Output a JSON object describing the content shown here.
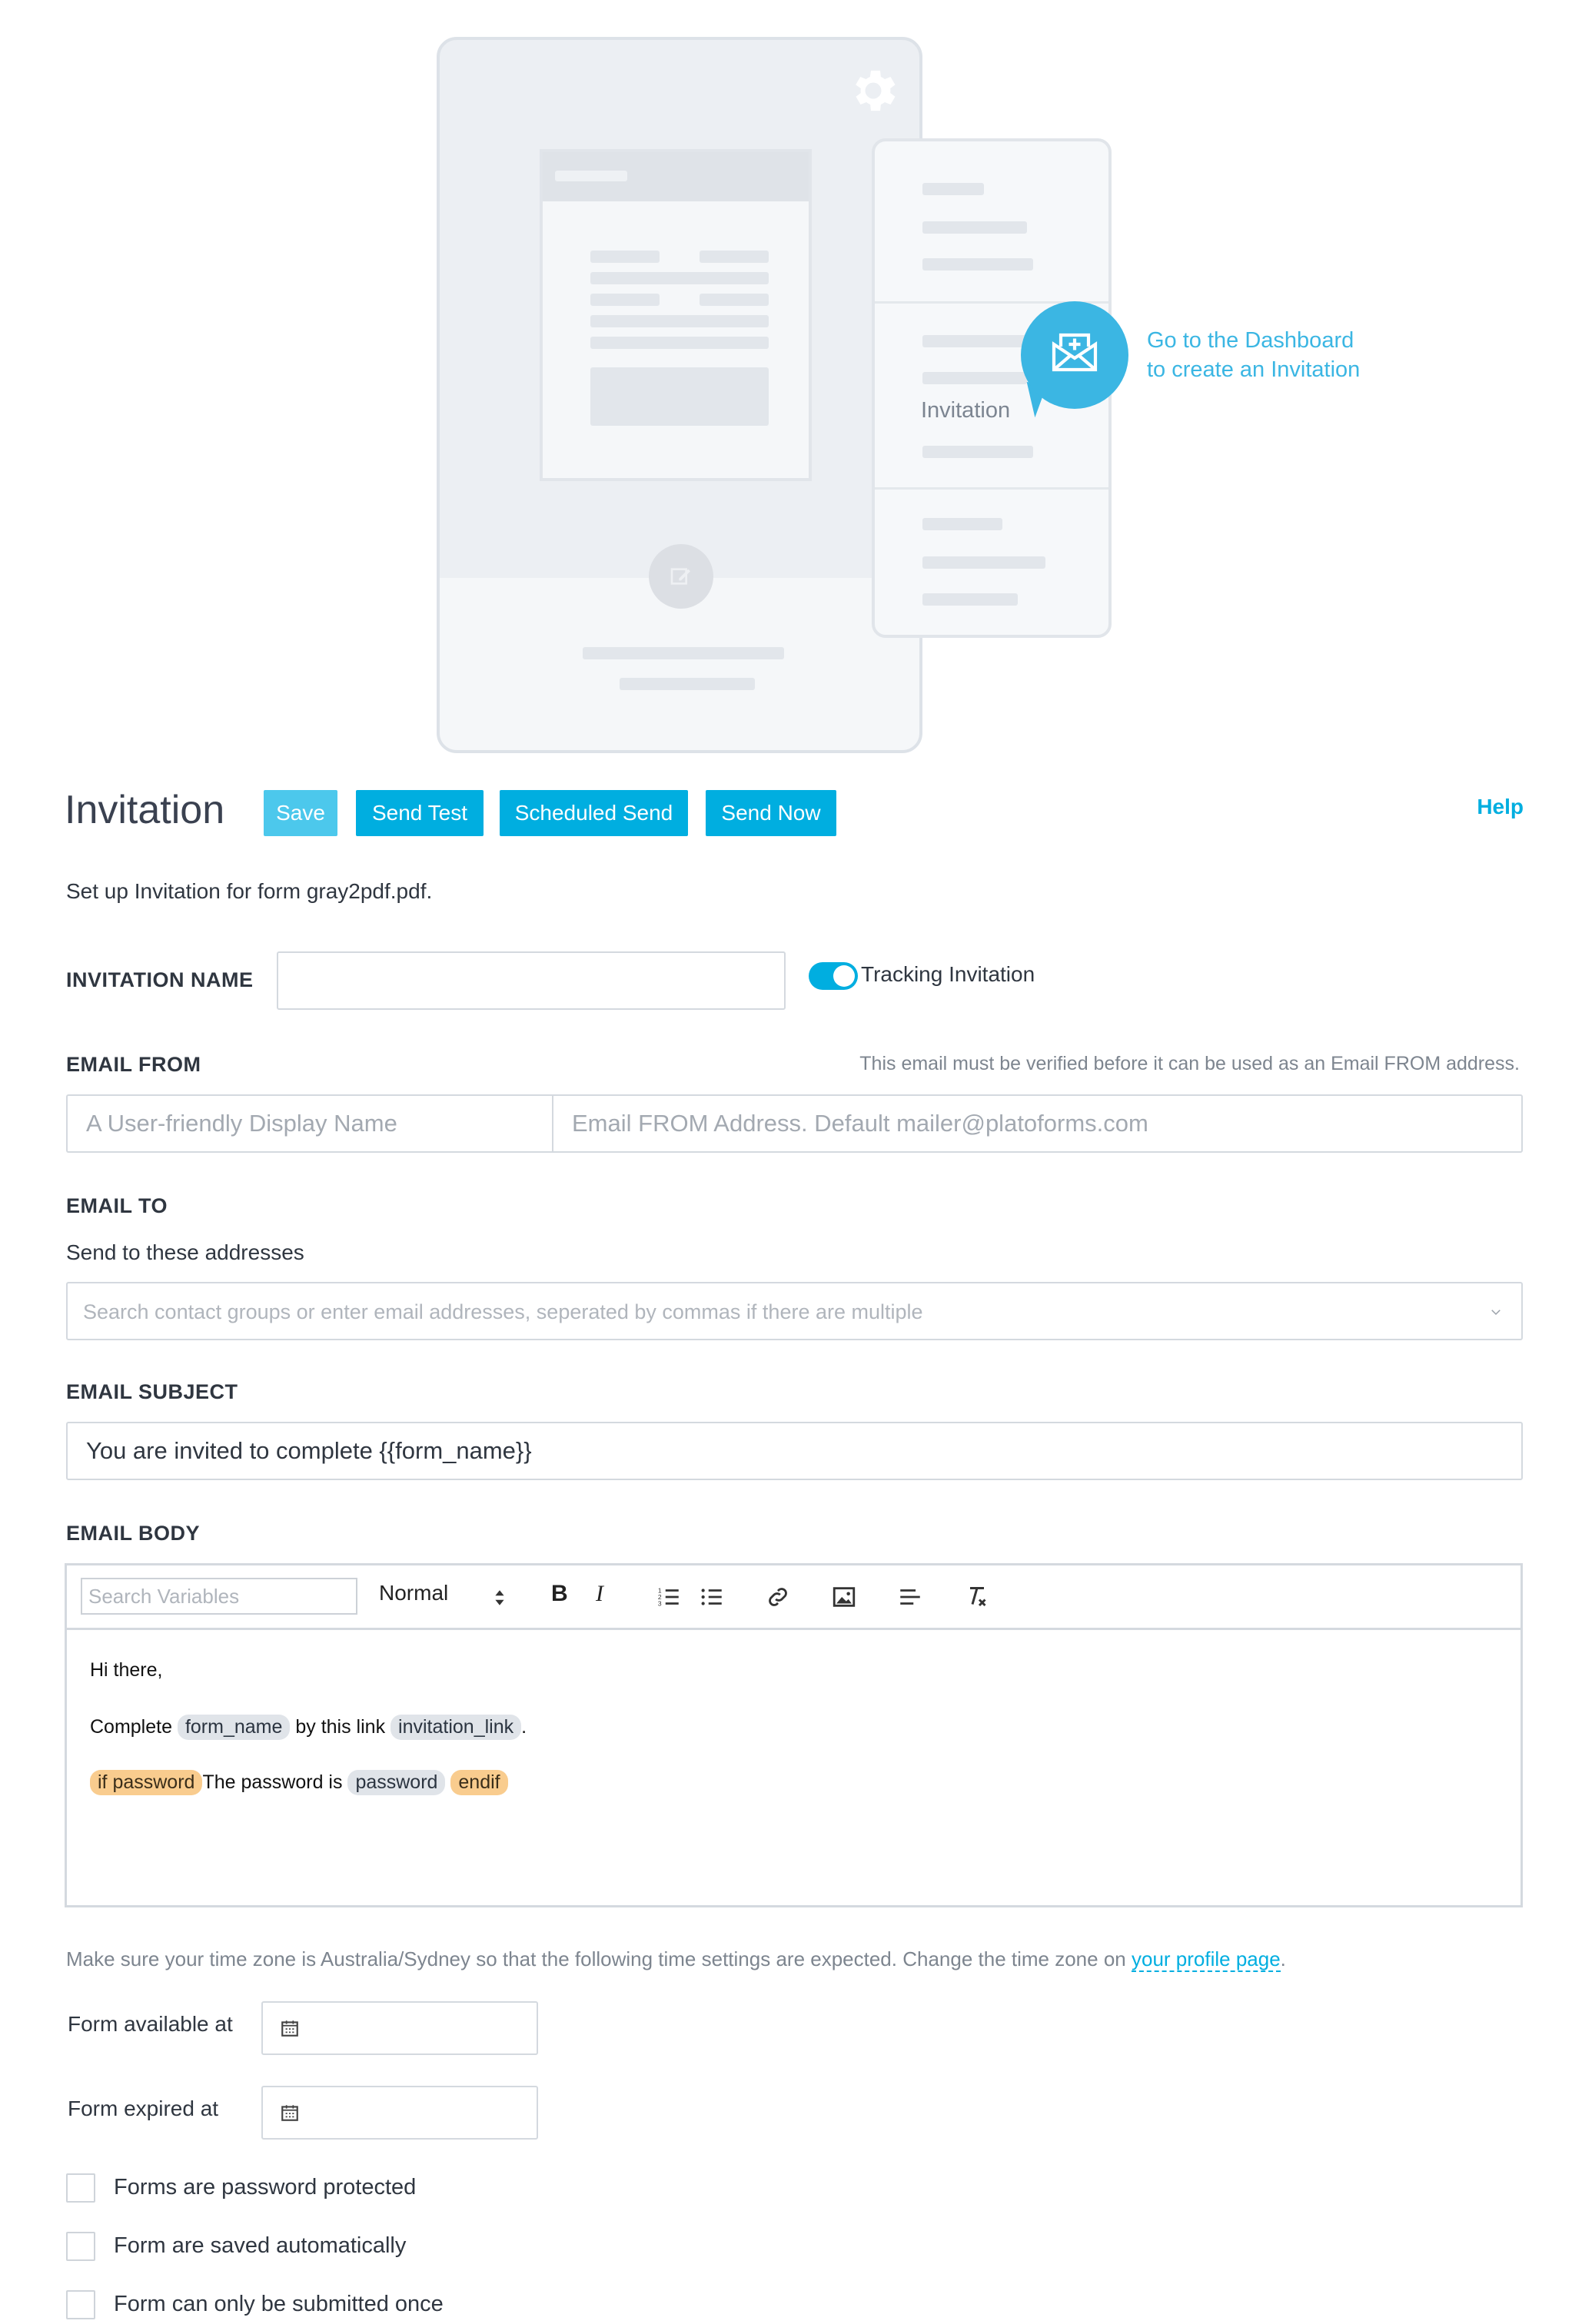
{
  "illustration": {
    "card_caption": "Invitation",
    "dashboard_hint": "Go to the Dashboard\nto create an Invitation"
  },
  "header": {
    "title": "Invitation",
    "buttons": {
      "save": "Save",
      "send_test": "Send Test",
      "scheduled_send": "Scheduled Send",
      "send_now": "Send Now"
    },
    "help": "Help"
  },
  "subtitle": "Set up Invitation for form gray2pdf.pdf.",
  "invitation_name": {
    "label": "INVITATION NAME",
    "value": "",
    "tracking_label": "Tracking Invitation",
    "tracking_on": true
  },
  "email_from": {
    "label": "EMAIL FROM",
    "hint": "This email must be verified before it can be used as an Email FROM address.",
    "name_placeholder": "A User-friendly Display Name",
    "address_placeholder": "Email FROM Address. Default mailer@platoforms.com"
  },
  "email_to": {
    "label": "EMAIL TO",
    "sublabel": "Send to these addresses",
    "placeholder": "Search contact groups or enter email addresses, seperated by commas if there are multiple"
  },
  "email_subject": {
    "label": "EMAIL SUBJECT",
    "value": "You are invited to complete {{form_name}}"
  },
  "email_body": {
    "label": "EMAIL BODY",
    "search_placeholder": "Search Variables",
    "format": "Normal",
    "lines": {
      "greeting": "Hi there,",
      "complete": "Complete",
      "form_name": "form_name",
      "by_link": "by this link",
      "invitation_link": "invitation_link",
      "period": ".",
      "if_password": "if password",
      "password_is": "The password is",
      "password": "password",
      "endif": "endif"
    }
  },
  "timezone_note": {
    "text": "Make sure your time zone is Australia/Sydney so that the following time settings are expected. Change the time zone on",
    "link": "your profile page",
    "end": "."
  },
  "dates": {
    "available_label": "Form available at",
    "expired_label": "Form expired at"
  },
  "options": [
    {
      "label": "Forms are password protected",
      "checked": false
    },
    {
      "label": "Form are saved automatically",
      "checked": false
    },
    {
      "label": "Form can only be submitted once",
      "checked": false
    }
  ],
  "colors": {
    "accent": "#00aee0",
    "chip": "#e0e4e9",
    "chip_conditional": "#f9cc8e"
  }
}
